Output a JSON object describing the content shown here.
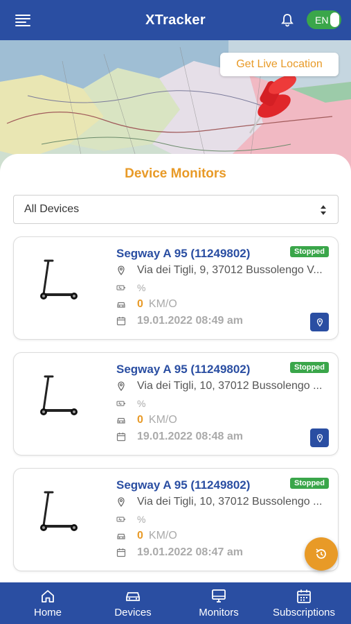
{
  "header": {
    "title": "XTracker",
    "language": "EN"
  },
  "map": {
    "live_location_label": "Get Live Location"
  },
  "section_title": "Device Monitors",
  "filter": {
    "selected": "All Devices"
  },
  "devices": [
    {
      "name": "Segway A 95 (11249802)",
      "status": "Stopped",
      "address": "Via dei Tigli, 9, 37012 Bussolengo V...",
      "battery": "%",
      "speed": "0",
      "speed_unit": "KM/O",
      "datetime": "19.01.2022 08:49 am"
    },
    {
      "name": "Segway A 95 (11249802)",
      "status": "Stopped",
      "address": "Via dei Tigli, 10, 37012 Bussolengo ...",
      "battery": "%",
      "speed": "0",
      "speed_unit": "KM/O",
      "datetime": "19.01.2022 08:48 am"
    },
    {
      "name": "Segway A 95 (11249802)",
      "status": "Stopped",
      "address": "Via dei Tigli, 10, 37012 Bussolengo ...",
      "battery": "%",
      "speed": "0",
      "speed_unit": "KM/O",
      "datetime": "19.01.2022 08:47 am"
    }
  ],
  "nav": {
    "home": "Home",
    "devices": "Devices",
    "monitors": "Monitors",
    "subscriptions": "Subscriptions"
  },
  "colors": {
    "primary": "#2a4ea2",
    "accent": "#e89a27",
    "status_green": "#3aa64a"
  }
}
